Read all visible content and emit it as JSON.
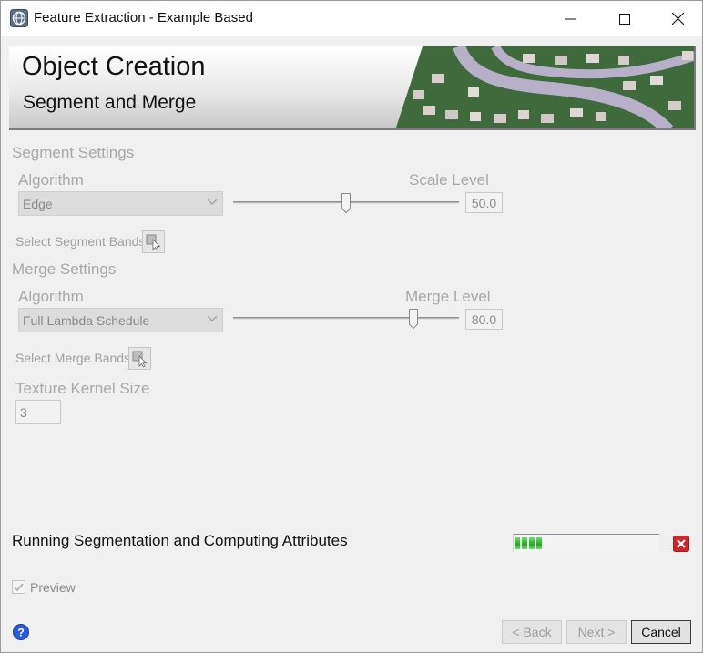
{
  "window": {
    "title": "Feature Extraction - Example Based"
  },
  "banner": {
    "title": "Object Creation",
    "subtitle": "Segment and Merge"
  },
  "segment": {
    "section_title": "Segment Settings",
    "algorithm_label": "Algorithm",
    "algorithm_value": "Edge",
    "level_label": "Scale Level",
    "level_value": "50.0",
    "level_fraction": 0.5,
    "bands_label": "Select Segment Bands"
  },
  "merge": {
    "section_title": "Merge Settings",
    "algorithm_label": "Algorithm",
    "algorithm_value": "Full Lambda Schedule",
    "level_label": "Merge Level",
    "level_value": "80.0",
    "level_fraction": 0.8,
    "bands_label": "Select Merge Bands"
  },
  "texture": {
    "label": "Texture Kernel Size",
    "value": "3"
  },
  "status": {
    "text": "Running Segmentation and Computing Attributes",
    "progress_fraction": 0.2
  },
  "preview": {
    "label": "Preview",
    "checked": true
  },
  "buttons": {
    "back": "< Back",
    "next": "Next >",
    "cancel": "Cancel"
  },
  "icons": {
    "app": "globe-app-icon",
    "minimize": "minimize-icon",
    "maximize": "maximize-icon",
    "close": "close-icon",
    "bands": "select-cursor-icon",
    "cancel_task": "red-x-icon",
    "help": "help-icon"
  },
  "colors": {
    "progress": "#1ea81e",
    "cancel_task": "#d0262a",
    "help": "#2a5ad6"
  }
}
